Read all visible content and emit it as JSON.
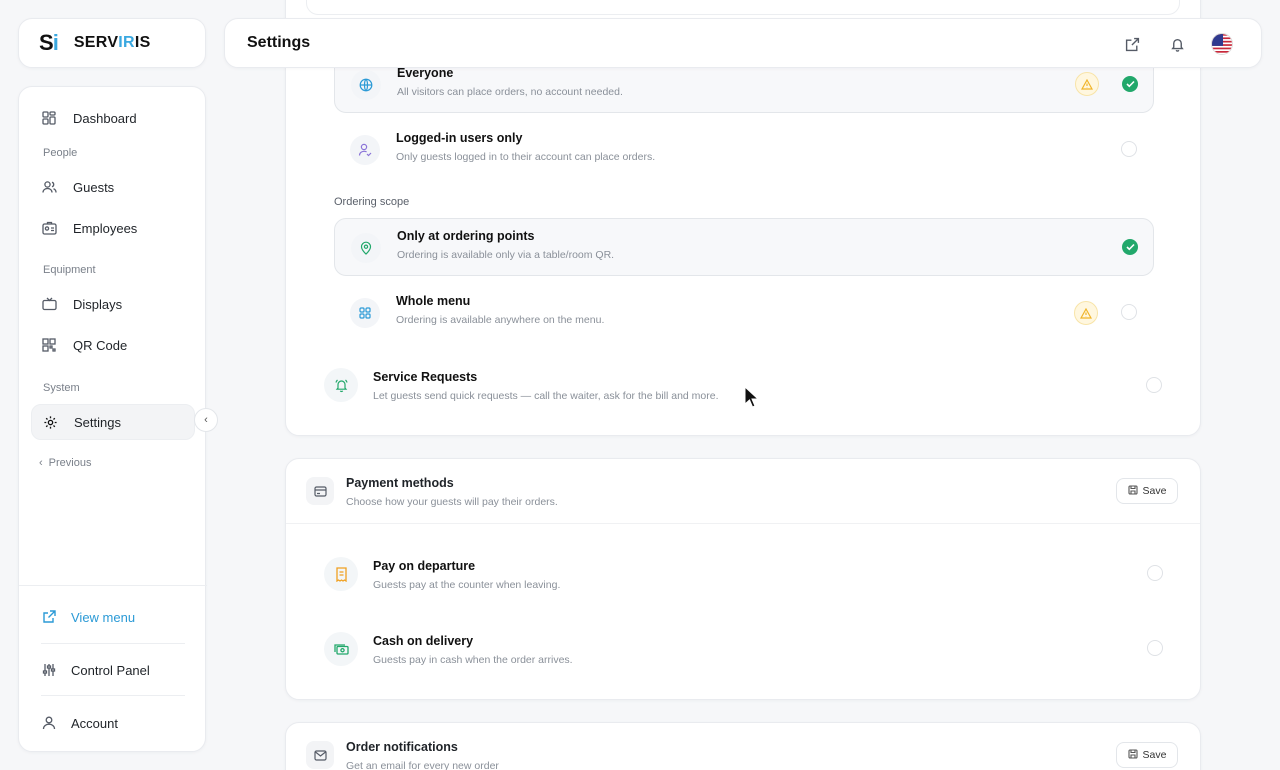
{
  "brand": {
    "mark_s": "S",
    "mark_i": "i",
    "name_a": "SERV",
    "name_b": "IR",
    "name_c": "IS"
  },
  "colors": {
    "accent": "#2b9ad6",
    "success": "#22a86b",
    "warning": "#f0b429"
  },
  "header": {
    "title": "Settings",
    "icons": [
      "external-link-icon",
      "bell-icon",
      "us-flag"
    ]
  },
  "sidebar": {
    "items": [
      {
        "label": "Dashboard",
        "icon": "dashboard-icon"
      },
      {
        "label": "Guests",
        "icon": "users-icon"
      },
      {
        "label": "Employees",
        "icon": "id-card-icon"
      },
      {
        "label": "Displays",
        "icon": "tv-icon"
      },
      {
        "label": "QR Code",
        "icon": "qr-icon"
      },
      {
        "label": "Settings",
        "icon": "gear-icon",
        "active": true
      }
    ],
    "sections": {
      "people": "People",
      "equipment": "Equipment",
      "system": "System"
    },
    "previous": "Previous",
    "bottom": {
      "view_menu": "View menu",
      "control_panel": "Control Panel",
      "account": "Account"
    }
  },
  "ordering": {
    "who": [
      {
        "title": "Everyone",
        "desc": "All visitors can place orders, no account needed.",
        "selected": true,
        "warning": true
      },
      {
        "title": "Logged-in users only",
        "desc": "Only guests logged in to their account can place orders.",
        "selected": false,
        "warning": false
      }
    ],
    "scope_label": "Ordering scope",
    "scope": [
      {
        "title": "Only at ordering points",
        "desc": "Ordering is available only via a table/room QR.",
        "selected": true,
        "warning": false
      },
      {
        "title": "Whole menu",
        "desc": "Ordering is available anywhere on the menu.",
        "selected": false,
        "warning": true
      }
    ]
  },
  "service_requests": {
    "title": "Service Requests",
    "desc": "Let guests send quick requests — call the waiter, ask for the bill and more.",
    "enabled": false
  },
  "payment": {
    "title": "Payment methods",
    "desc": "Choose how your guests will pay their orders.",
    "save": "Save",
    "methods": [
      {
        "title": "Pay on departure",
        "desc": "Guests pay at the counter when leaving.",
        "enabled": false
      },
      {
        "title": "Cash on delivery",
        "desc": "Guests pay in cash when the order arrives.",
        "enabled": false
      }
    ]
  },
  "notifications": {
    "title": "Order notifications",
    "desc": "Get an email for every new order",
    "save": "Save"
  }
}
